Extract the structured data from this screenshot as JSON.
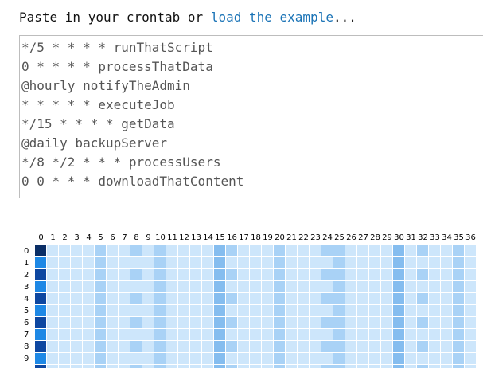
{
  "intro": {
    "prefix": "Paste in your crontab or ",
    "link": "load the example",
    "suffix": "..."
  },
  "crontab": {
    "lines": [
      "*/5 * * * * runThatScript",
      "0 * * * * processThatData",
      "@hourly notifyTheAdmin",
      "* * * * * executeJob",
      "*/15 * * * * getData",
      "@daily backupServer",
      "*/8 */2 * * * processUsers",
      "0 0 * * * downloadThatContent"
    ]
  },
  "heatmap": {
    "minute_labels": [
      "0",
      "1",
      "2",
      "3",
      "4",
      "5",
      "6",
      "7",
      "8",
      "9",
      "10",
      "11",
      "12",
      "13",
      "14",
      "15",
      "16",
      "17",
      "18",
      "19",
      "20",
      "21",
      "22",
      "23",
      "24",
      "25",
      "26",
      "27",
      "28",
      "29",
      "30",
      "31",
      "32",
      "33",
      "34",
      "35",
      "36"
    ],
    "hour_labels": [
      "0",
      "1",
      "2",
      "3",
      "4",
      "5",
      "6",
      "7",
      "8",
      "9"
    ],
    "colors": {
      "base": "#cde6fb",
      "level1": "#a9d2f6",
      "level2": "#85bdef",
      "level3": "#1e88e5",
      "level4": "#1565c0",
      "level5": "#0d47a1",
      "level6": "#0a2e66"
    }
  }
}
